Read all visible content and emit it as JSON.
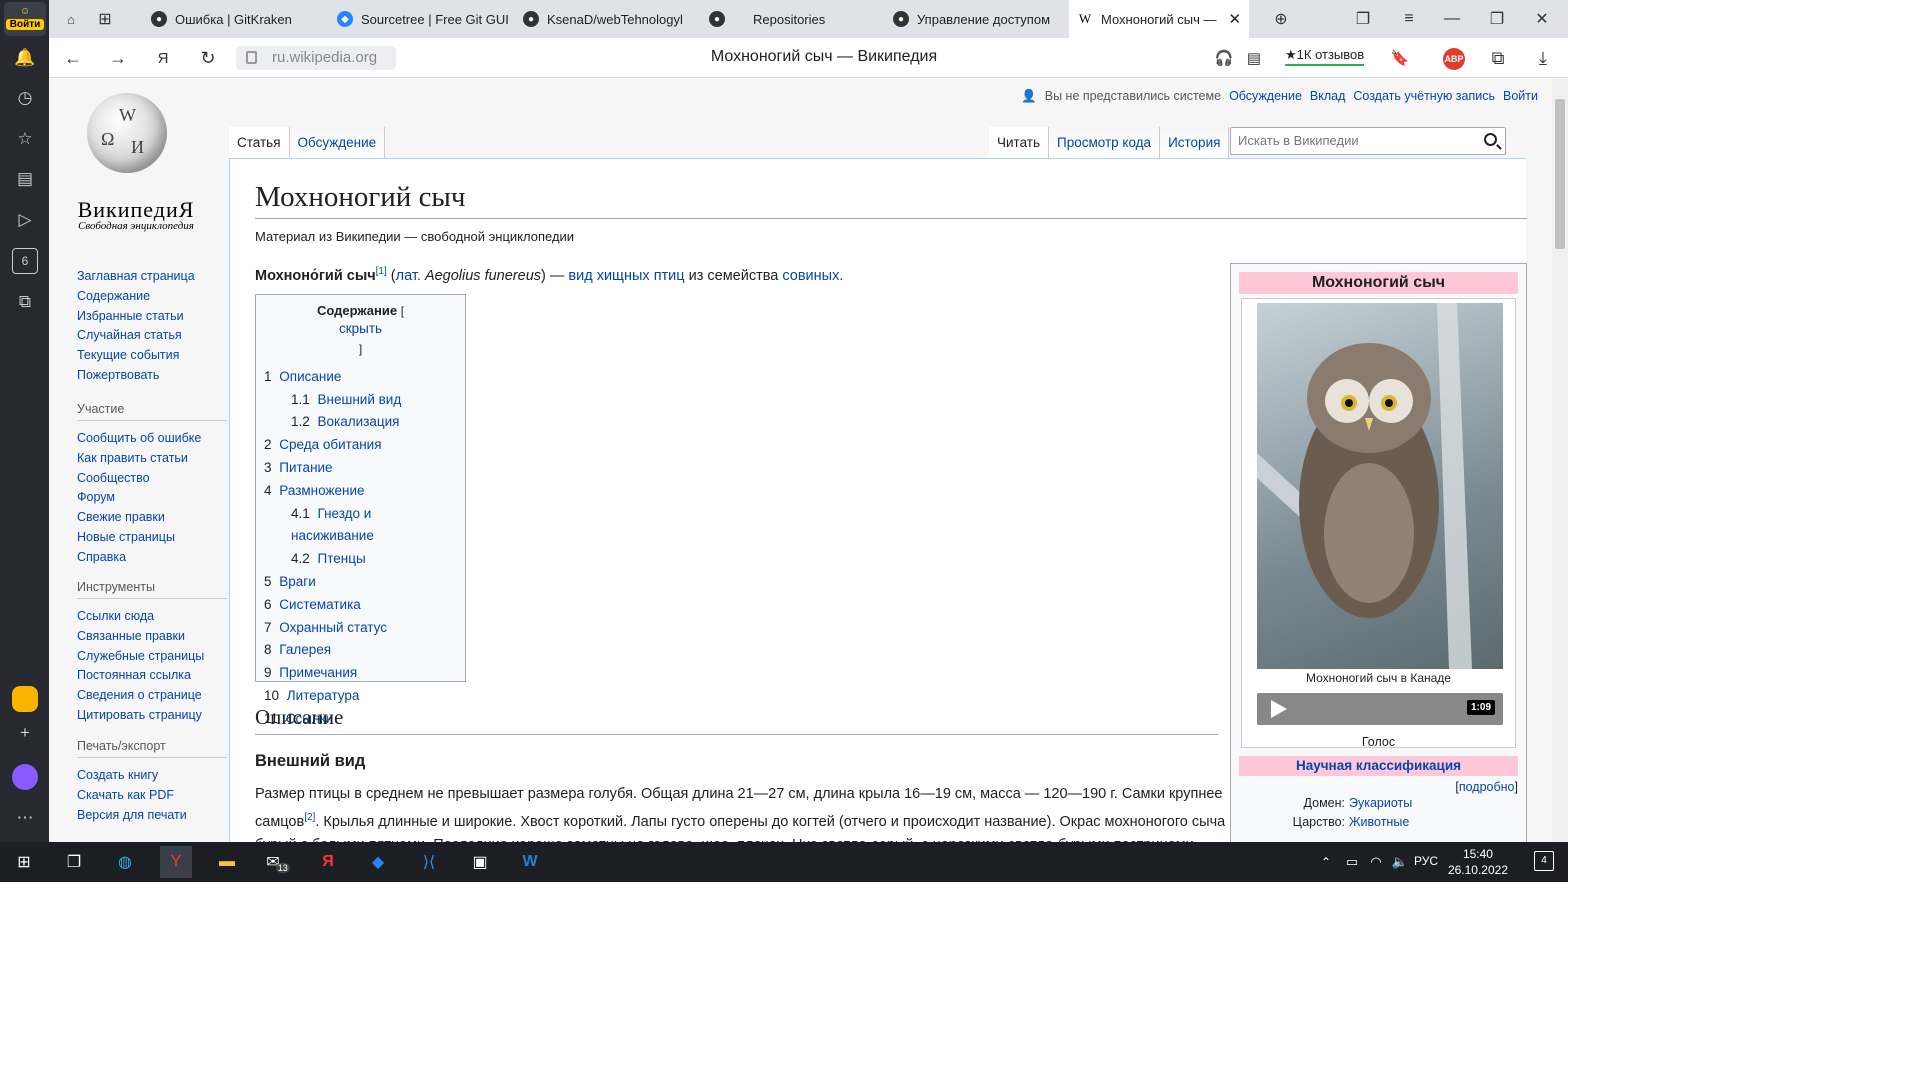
{
  "sidebar": {
    "login": "Войти",
    "tab_count": "6"
  },
  "tabs": [
    {
      "label": "Ошибка | GitKraken"
    },
    {
      "label": "Sourcetree | Free Git GUI"
    },
    {
      "label": "KsenaD/webTehnologyl"
    },
    {
      "label": "Repositories"
    },
    {
      "label": "Управление доступом"
    },
    {
      "label": "Мохноногий сыч —"
    }
  ],
  "address": {
    "url": "ru.wikipedia.org",
    "title": "Мохноногий сыч — Википедия",
    "reviews": "1К отзывов",
    "abp": "ABP"
  },
  "wiki": {
    "wordmark": "ВикипедиЯ",
    "tagline": "Свободная энциклопедия",
    "personal": [
      "Вы не представились системе",
      "Обсуждение",
      "Вклад",
      "Создать учётную запись",
      "Войти"
    ],
    "tabs_left": [
      "Статья",
      "Обсуждение"
    ],
    "tabs_right": [
      "Читать",
      "Просмотр кода",
      "История"
    ],
    "search_placeholder": "Искать в Википедии",
    "nav": [
      "Заглавная страница",
      "Содержание",
      "Избранные статьи",
      "Случайная статья",
      "Текущие события",
      "Пожертвовать"
    ],
    "participation_title": "Участие",
    "participation": [
      "Сообщить об ошибке",
      "Как править статьи",
      "Сообщество",
      "Форум",
      "Свежие правки",
      "Новые страницы",
      "Справка"
    ],
    "tools_title": "Инструменты",
    "tools": [
      "Ссылки сюда",
      "Связанные правки",
      "Служебные страницы",
      "Постоянная ссылка",
      "Сведения о странице",
      "Цитировать страницу"
    ],
    "print_title": "Печать/экспорт",
    "print": [
      "Создать книгу",
      "Скачать как PDF",
      "Версия для печати"
    ]
  },
  "article": {
    "title": "Мохноногий сыч",
    "subtitle": "Материал из Википедии — свободной энциклопедии",
    "lead_bold": "Мохноно́гий сыч",
    "lead_ref": "[1]",
    "lead_lat": "лат.",
    "lead_latin": "Aegolius funereus",
    "lead_dash": ") —",
    "lead_vid": "вид",
    "lead_birds": "хищных птиц",
    "lead_fam": "из семейства",
    "lead_owls": "совиных",
    "toc_title": "Содержание",
    "toc_hide": "скрыть",
    "toc": [
      {
        "num": "1",
        "text": "Описание"
      },
      {
        "num": "1.1",
        "text": "Внешний вид"
      },
      {
        "num": "1.2",
        "text": "Вокализация"
      },
      {
        "num": "2",
        "text": "Среда обитания"
      },
      {
        "num": "3",
        "text": "Питание"
      },
      {
        "num": "4",
        "text": "Размножение"
      },
      {
        "num": "4.1",
        "text": "Гнездо и насиживание"
      },
      {
        "num": "4.2",
        "text": "Птенцы"
      },
      {
        "num": "5",
        "text": "Враги"
      },
      {
        "num": "6",
        "text": "Систематика"
      },
      {
        "num": "7",
        "text": "Охранный статус"
      },
      {
        "num": "8",
        "text": "Галерея"
      },
      {
        "num": "9",
        "text": "Примечания"
      },
      {
        "num": "10",
        "text": "Литература"
      },
      {
        "num": "11",
        "text": "Ссылки"
      }
    ],
    "h2": "Описание",
    "h3": "Внешний вид",
    "para_1": "Размер птицы в среднем не превышает размера голубя. Общая длина 21—27 см, длина крыла 16—19 см, масса — 120—190 г. Самки крупнее самцов",
    "para_ref": "[2]",
    "para_2": ". Крылья длинные и широкие. Хвост короткий. Лапы густо оперены до когтей (отчего и происходит название). Окрас мохноногого сыча бурый с белыми пятнами. Последние хорошо заметны на голове, шее, плечах. Низ светло-серый, с нерезкими светло-бурыми пестринами."
  },
  "infobox": {
    "title": "Мохноногий сыч",
    "caption": "Мохноногий сыч в Канаде",
    "duration": "1:09",
    "voice": "Голос",
    "classification": "Научная классификация",
    "more": "подробно",
    "rows": [
      {
        "k": "Домен:",
        "v": "Эукариоты"
      },
      {
        "k": "Царство:",
        "v": "Животные"
      }
    ]
  },
  "taskbar": {
    "mail_count": "13",
    "lang": "РУС",
    "time": "15:40",
    "date": "26.10.2022",
    "notifications": "4"
  }
}
